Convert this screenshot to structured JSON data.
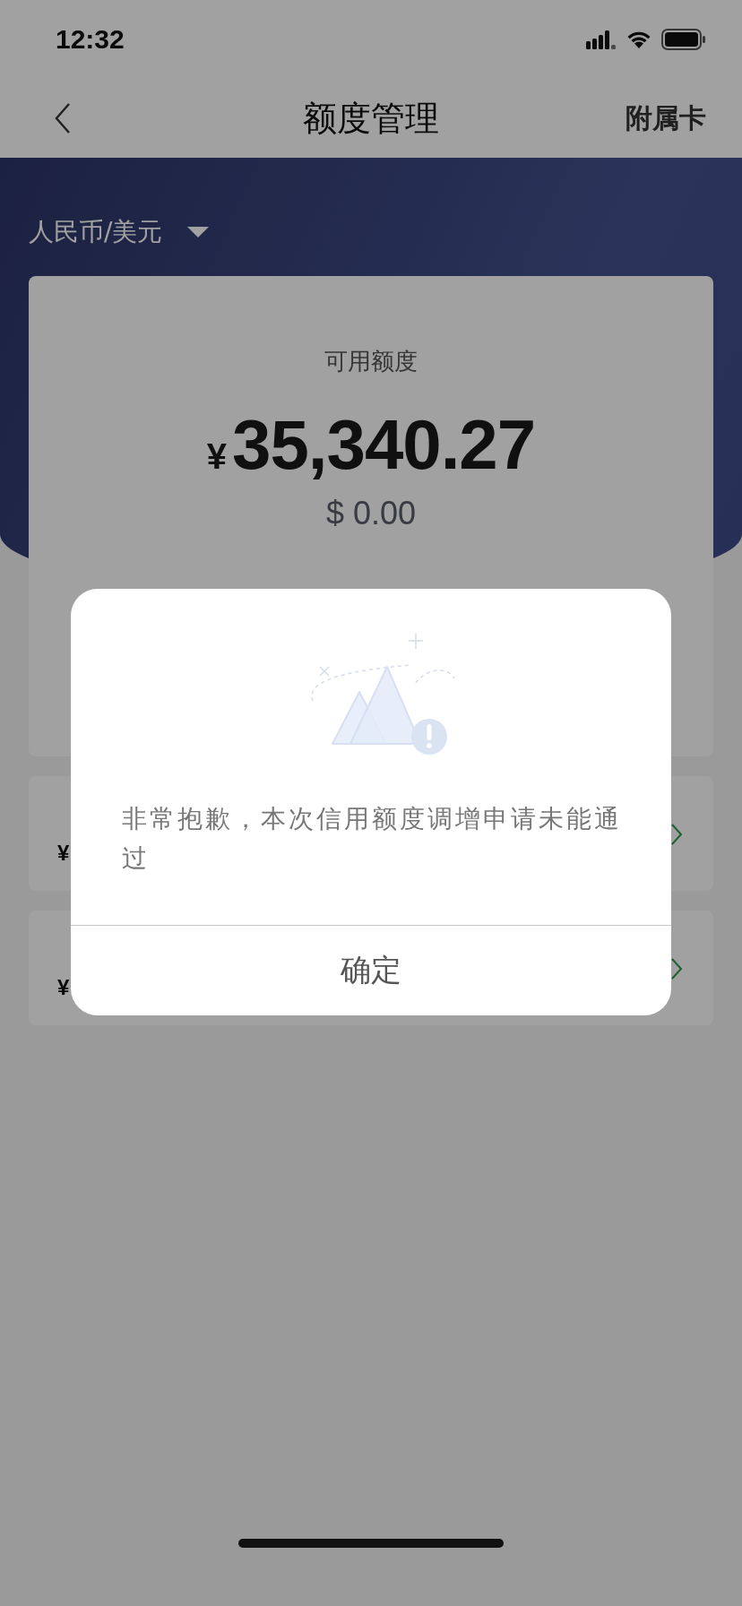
{
  "status_bar": {
    "time": "12:32"
  },
  "nav": {
    "title": "额度管理",
    "action": "附属卡"
  },
  "currency_selector": {
    "label": "人民币/美元"
  },
  "balance_card": {
    "label": "可用额度",
    "currency_symbol": "¥",
    "amount": "35,340.27",
    "secondary": "$ 0.00"
  },
  "rows": [
    {
      "value": "¥"
    },
    {
      "value": "¥"
    }
  ],
  "dialog": {
    "message": "非常抱歉，本次信用额度调增申请未能通过",
    "button": "确定"
  }
}
